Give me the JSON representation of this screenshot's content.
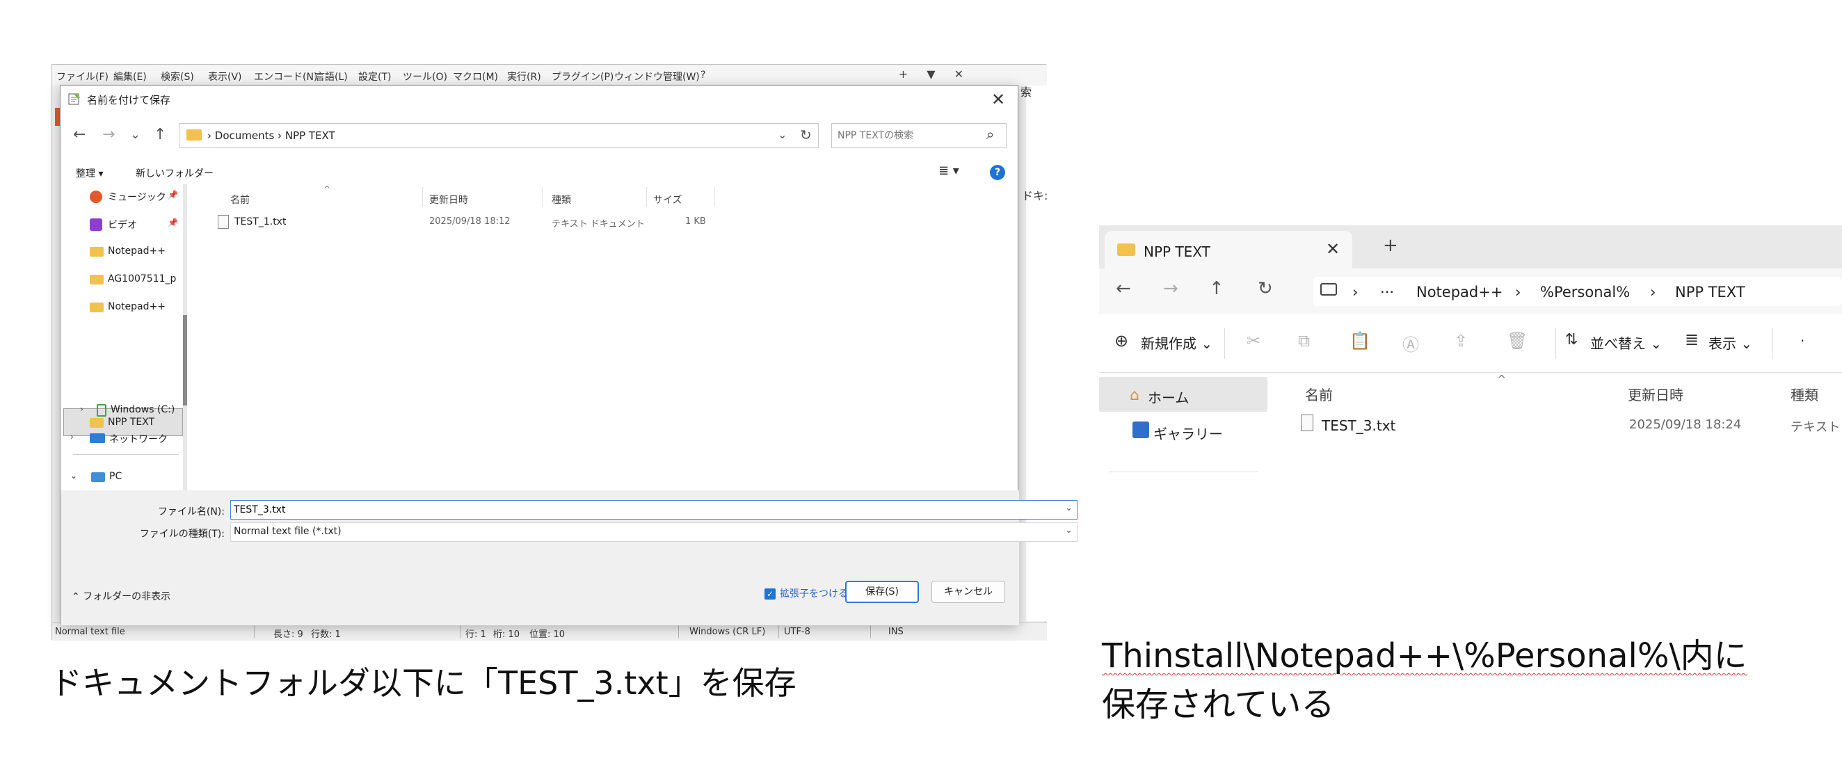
{
  "npp": {
    "menu": [
      "ファイル(F)",
      "編集(E)",
      "検索(S)",
      "表示(V)",
      "エンコード(N)",
      "言語(L)",
      "設定(T)",
      "ツール(O)",
      "マクロ(M)",
      "実行(R)",
      "プラグイン(P)",
      "ウィンドウ管理(W)",
      "?"
    ],
    "win_controls": [
      "+",
      "▼",
      "✕"
    ],
    "right_partial_1": "索",
    "right_partial_2": "ドキ:",
    "status": [
      "Normal text file",
      "長さ: 9",
      "行数: 1",
      "行: 1",
      "桁: 10",
      "位置: 10",
      "Windows (CR LF)",
      "UTF-8",
      "INS"
    ]
  },
  "dialog": {
    "title": "名前を付けて保存",
    "close": "✕",
    "nav": {
      "back": "←",
      "forward": "→",
      "recent": "⌄",
      "up": "↑"
    },
    "address": "›  Documents  ›  NPP TEXT",
    "address_dd": "⌄",
    "refresh": "↻",
    "search_placeholder": "NPP TEXTの検索",
    "toolbar": {
      "organize": "整理 ▾",
      "new_folder": "新しいフォルダー",
      "view": "≣ ▾",
      "help": "?"
    },
    "nav_pane": [
      {
        "label": "ミュージック",
        "pinned": true
      },
      {
        "label": "ビデオ",
        "pinned": true
      },
      {
        "label": "Notepad++"
      },
      {
        "label": "AG1007511_p"
      },
      {
        "label": "Notepad++"
      },
      {
        "label": "NPP TEXT"
      },
      {
        "label": "PC"
      },
      {
        "label": "Windows (C:)"
      },
      {
        "label": "ネットワーク"
      }
    ],
    "columns": [
      "名前",
      "更新日時",
      "種類",
      "サイズ"
    ],
    "files": [
      {
        "name": "TEST_1.txt",
        "modified": "2025/09/18 18:12",
        "type": "テキスト ドキュメント",
        "size": "1 KB"
      }
    ],
    "filename_label": "ファイル名(N):",
    "filename_value": "TEST_3.txt",
    "filetype_label": "ファイルの種類(T):",
    "filetype_value": "Normal text file (*.txt)",
    "hide_folders": "フォルダーの非表示",
    "ext_checkbox": "拡張子をつける(A)",
    "save": "保存(S)",
    "cancel": "キャンセル"
  },
  "caption_left": "ドキュメントフォルダ以下に「TEST_3.txt」を保存",
  "explorer": {
    "tab_title": "NPP TEXT",
    "tab_close": "✕",
    "tab_new": "+",
    "crumbs": [
      "›",
      "···",
      "Notepad++",
      "›",
      "%Personal%",
      "›",
      "NPP TEXT"
    ],
    "new": "新規作成 ⌄",
    "sort": "並べ替え ⌄",
    "view": "表示 ⌄",
    "home": "ホーム",
    "gallery": "ギャラリー",
    "columns": [
      "名前",
      "更新日時",
      "種類"
    ],
    "files": [
      {
        "name": "TEST_3.txt",
        "modified": "2025/09/18 18:24",
        "type": "テキスト ドキュメント"
      }
    ]
  },
  "caption_right": {
    "line1": "Thinstall\\Notepad++\\%Personal%\\内に",
    "line2": "保存されている"
  }
}
